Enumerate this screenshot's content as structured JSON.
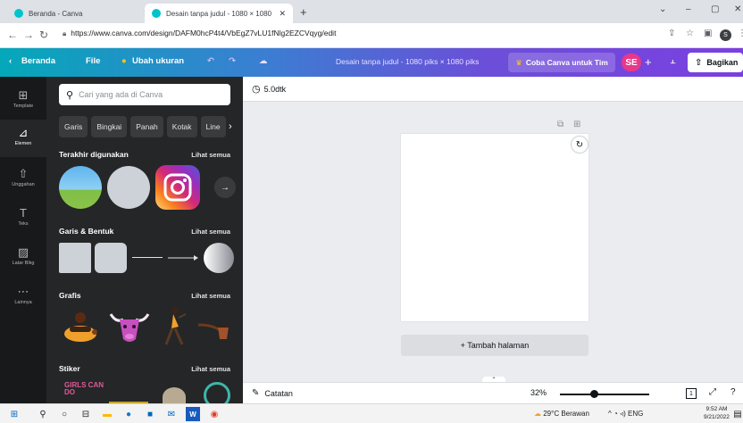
{
  "browser": {
    "tabs": [
      {
        "title": "Beranda - Canva",
        "active": false
      },
      {
        "title": "Desain tanpa judul - 1080 × 1080",
        "active": true
      }
    ],
    "new_tab": "+",
    "window_controls": {
      "minimize": "–",
      "maximize": "▢",
      "close": "✕",
      "tab_search": "⌄"
    },
    "url": "https://www.canva.com/design/DAFM0hcP4t4/VbEgZ7vLU1fNlg2EZCVqyg/edit"
  },
  "canva_bar": {
    "home": "Beranda",
    "file": "File",
    "resize": "Ubah ukuran",
    "title": "Desain tanpa judul - 1080 piks × 1080 piks",
    "try_team": "Coba Canva untuk Tim",
    "avatar": "SE",
    "share": "Bagikan",
    "colors": {
      "share_bg": "#ffffff",
      "avatar_bg": "#e8388a"
    }
  },
  "rail": [
    {
      "label": "Template",
      "icon": "template-icon",
      "active": false
    },
    {
      "label": "Elemen",
      "icon": "elements-icon",
      "active": true
    },
    {
      "label": "Unggahan",
      "icon": "upload-icon",
      "active": false
    },
    {
      "label": "Teks",
      "icon": "text-icon",
      "active": false
    },
    {
      "label": "Latar Blkg",
      "icon": "background-icon",
      "active": false
    },
    {
      "label": "Lainnya",
      "icon": "more-icon",
      "active": false
    }
  ],
  "panel": {
    "search_placeholder": "Cari yang ada di Canva",
    "chips": [
      "Garis",
      "Bingkai",
      "Panah",
      "Kotak",
      "Line"
    ],
    "see_all": "Lihat semua",
    "sections": {
      "recent": "Terakhir digunakan",
      "shapes": "Garis & Bentuk",
      "graphics": "Grafis",
      "stickers": "Stiker"
    },
    "sticker_text": "GIRLS CAN DO"
  },
  "editor": {
    "timer": "5.0dtk",
    "add_page": "+ Tambah halaman",
    "notes": "Catatan",
    "zoom": "32%",
    "zoom_fraction": 0.32,
    "page_number": "1"
  },
  "taskbar": {
    "weather": "29°C Berawan",
    "language": "ENG",
    "time": "9:52 AM",
    "date": "9/21/2022"
  }
}
